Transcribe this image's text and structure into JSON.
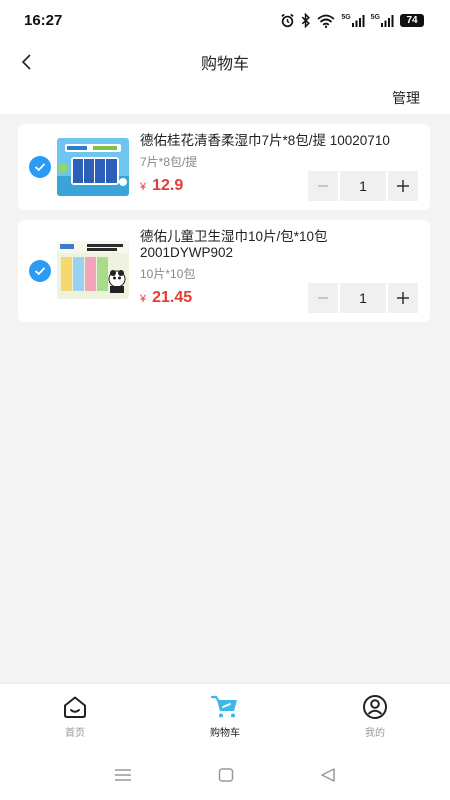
{
  "status_bar": {
    "time": "16:27",
    "battery": "74",
    "net1": "5G",
    "net2": "5G"
  },
  "nav": {
    "title": "购物车"
  },
  "manage": {
    "label": "管理"
  },
  "cart_items": [
    {
      "name": "德佑桂花清香柔湿巾7片*8包/提 10020710",
      "spec": "7片*8包/提",
      "currency": "¥",
      "price": "12.9",
      "quantity": "1",
      "checked": true
    },
    {
      "name": "德佑儿童卫生湿巾10片/包*10包 2001DYWP902",
      "spec": "10片*10包",
      "currency": "¥",
      "price": "21.45",
      "quantity": "1",
      "checked": true
    }
  ],
  "tabs": [
    {
      "label": "首页",
      "icon": "home-icon"
    },
    {
      "label": "购物车",
      "icon": "cart-icon",
      "active": true
    },
    {
      "label": "我的",
      "icon": "user-icon"
    }
  ],
  "colors": {
    "accent": "#2b9bf4",
    "price": "#e63b32",
    "cart_tab": "#3bb8e8"
  }
}
